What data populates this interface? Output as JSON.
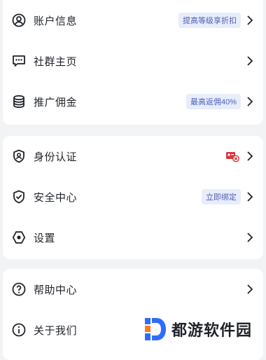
{
  "section1": {
    "items": [
      {
        "label": "账户信息",
        "badge": "提高等级享折扣",
        "icon": "user-circle-icon"
      },
      {
        "label": "社群主页",
        "badge": "",
        "icon": "chat-bubble-icon"
      },
      {
        "label": "推广佣金",
        "badge": "最高返佣40%",
        "icon": "database-coins-icon"
      }
    ]
  },
  "section2": {
    "items": [
      {
        "label": "身份认证",
        "badge": "",
        "icon": "shield-user-icon",
        "status": "unverified-card-icon"
      },
      {
        "label": "安全中心",
        "badge": "立即绑定",
        "icon": "shield-check-icon"
      },
      {
        "label": "设置",
        "badge": "",
        "icon": "hexagon-settings-icon"
      }
    ]
  },
  "section3": {
    "items": [
      {
        "label": "帮助中心",
        "badge": "",
        "icon": "question-circle-icon"
      },
      {
        "label": "关于我们",
        "badge": "",
        "icon": "info-circle-icon"
      }
    ]
  },
  "watermark": {
    "text": "都游软件园"
  },
  "colors": {
    "badge_text": "#4a5fb5",
    "badge_bg": "#e8edfb",
    "warn": "#d9363e",
    "accent_logo": "#2f6bff"
  }
}
